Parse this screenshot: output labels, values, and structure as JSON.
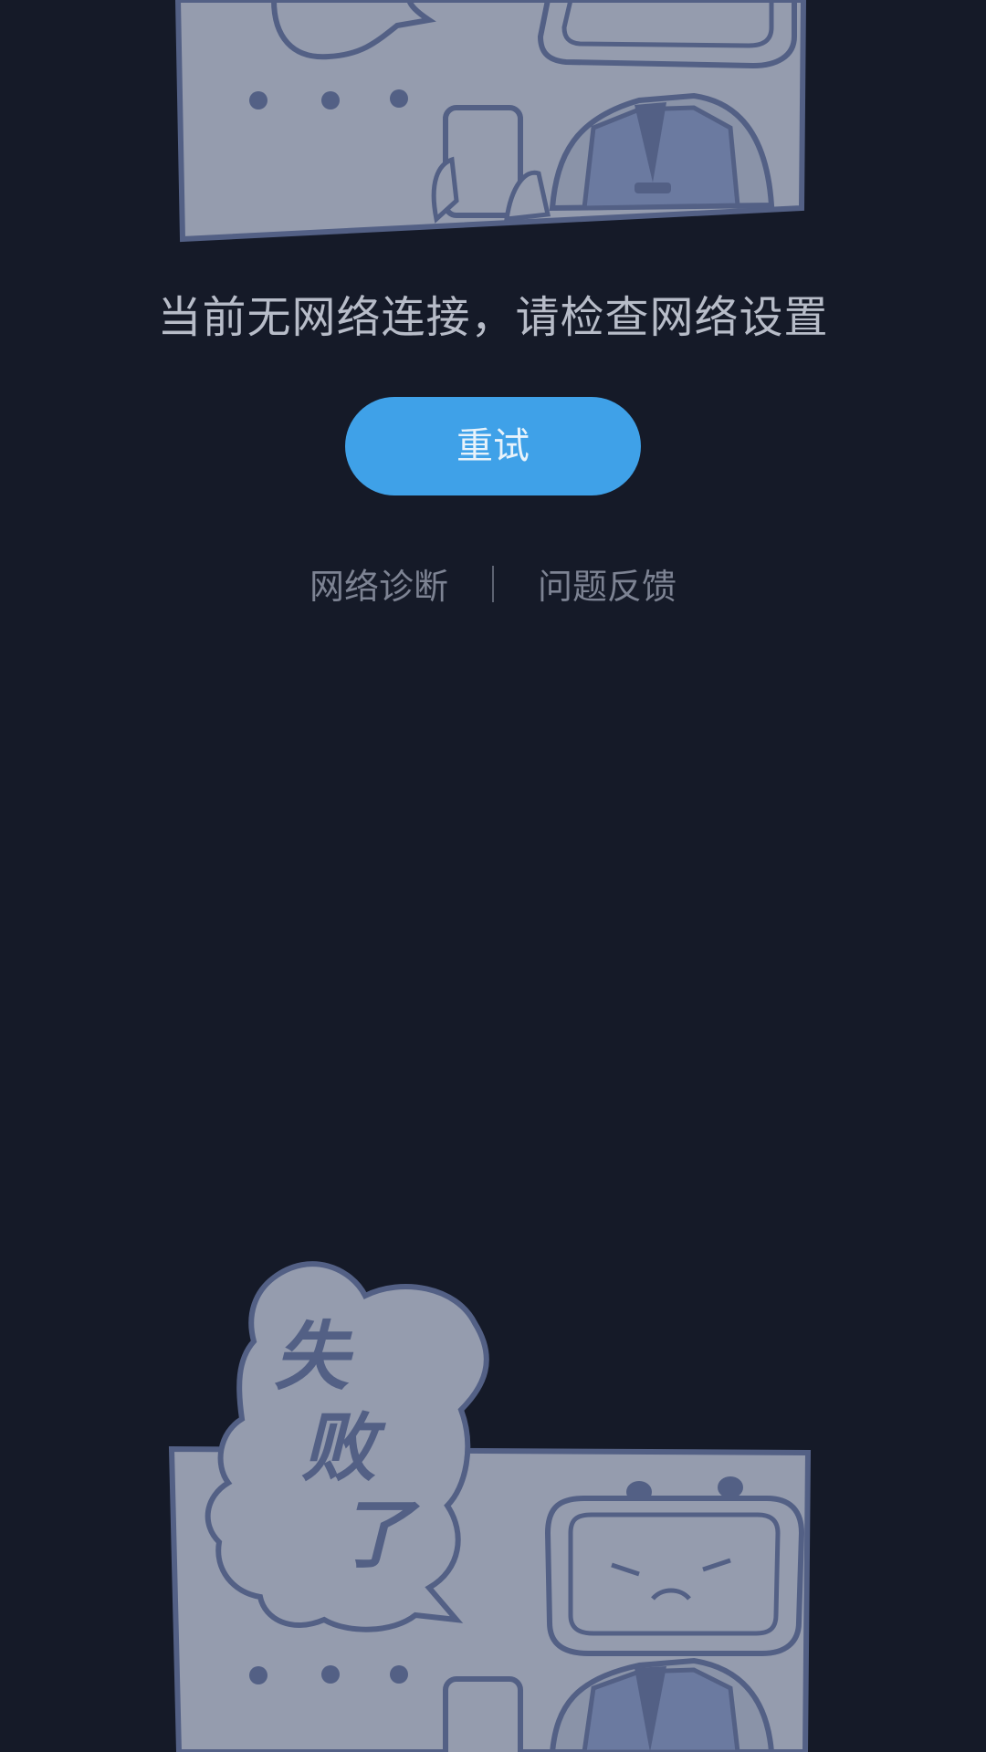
{
  "colors": {
    "background": "#151a28",
    "accent": "#3fa1e8",
    "illustration_fill": "#959cae",
    "illustration_stroke": "#536085"
  },
  "error": {
    "message": "当前无网络连接，请检查网络设置"
  },
  "actions": {
    "retry_label": "重试",
    "diagnose_label": "网络诊断",
    "feedback_label": "问题反馈"
  },
  "illustration_bottom": {
    "bubble_text": [
      "失",
      "败",
      "了"
    ]
  }
}
